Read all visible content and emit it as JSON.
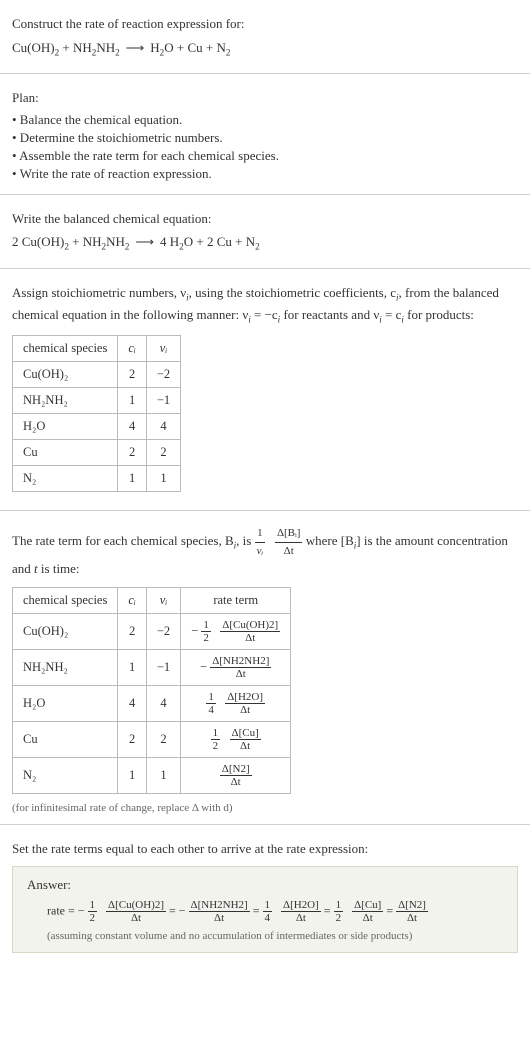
{
  "s1": {
    "intro": "Construct the rate of reaction expression for:",
    "eq_lhs1": "Cu(OH)",
    "eq_lhs1_sub": "2",
    "eq_plus1": " + NH",
    "eq_lhs2_sub": "2",
    "eq_lhs3": "NH",
    "eq_lhs3_sub": "2",
    "arrow": "⟶",
    "rhs1": "H",
    "rhs1_sub": "2",
    "rhs2": "O + Cu + N",
    "rhs2_sub": "2"
  },
  "s2": {
    "title": "Plan:",
    "b1": "• Balance the chemical equation.",
    "b2": "• Determine the stoichiometric numbers.",
    "b3": "• Assemble the rate term for each chemical species.",
    "b4": "• Write the rate of reaction expression."
  },
  "s3": {
    "title": "Write the balanced chemical equation:",
    "c1": "2 Cu(OH)",
    "c1s": "2",
    "c2": " + NH",
    "c2s": "2",
    "c3": "NH",
    "c3s": "2",
    "arrow": "⟶",
    "c4": "4 H",
    "c4s": "2",
    "c5": "O + 2 Cu + N",
    "c5s": "2"
  },
  "s4": {
    "t1": "Assign stoichiometric numbers, ν",
    "t1s": "i",
    "t2": ", using the stoichiometric coefficients, c",
    "t2s": "i",
    "t3": ", from the balanced chemical equation in the following manner: ν",
    "t3s": "i",
    "t4": " = −c",
    "t4s": "i",
    "t5": " for reactants and ν",
    "t5s": "i",
    "t6": " = c",
    "t6s": "i",
    "t7": " for products:",
    "h1": "chemical species",
    "h2": "cᵢ",
    "h3": "νᵢ",
    "r1a": "Cu(OH)₂",
    "r1b": "2",
    "r1c": "−2",
    "r2a": "NH₂NH₂",
    "r2b": "1",
    "r2c": "−1",
    "r3a": "H₂O",
    "r3b": "4",
    "r3c": "4",
    "r4a": "Cu",
    "r4b": "2",
    "r4c": "2",
    "r5a": "N₂",
    "r5b": "1",
    "r5c": "1"
  },
  "s5": {
    "t1": "The rate term for each chemical species, B",
    "t1s": "i",
    "t2": ", is ",
    "f1n": "1",
    "f1d": "νᵢ",
    "f2n": "Δ[Bᵢ]",
    "f2d": "Δt",
    "t3": " where [B",
    "t3s": "i",
    "t4": "] is the amount concentration and ",
    "t5": "t",
    "t6": " is time:",
    "h1": "chemical species",
    "h2": "cᵢ",
    "h3": "νᵢ",
    "h4": "rate term",
    "r1a": "Cu(OH)₂",
    "r1b": "2",
    "r1c": "−2",
    "r1d_pre": "−",
    "r1d_f1n": "1",
    "r1d_f1d": "2",
    "r1d_f2n": "Δ[Cu(OH)2]",
    "r1d_f2d": "Δt",
    "r2a": "NH₂NH₂",
    "r2b": "1",
    "r2c": "−1",
    "r2d_pre": "−",
    "r2d_f2n": "Δ[NH2NH2]",
    "r2d_f2d": "Δt",
    "r3a": "H₂O",
    "r3b": "4",
    "r3c": "4",
    "r3d_f1n": "1",
    "r3d_f1d": "4",
    "r3d_f2n": "Δ[H2O]",
    "r3d_f2d": "Δt",
    "r4a": "Cu",
    "r4b": "2",
    "r4c": "2",
    "r4d_f1n": "1",
    "r4d_f1d": "2",
    "r4d_f2n": "Δ[Cu]",
    "r4d_f2d": "Δt",
    "r5a": "N₂",
    "r5b": "1",
    "r5c": "1",
    "r5d_f2n": "Δ[N2]",
    "r5d_f2d": "Δt",
    "note": "(for infinitesimal rate of change, replace Δ with d)"
  },
  "s6": {
    "title": "Set the rate terms equal to each other to arrive at the rate expression:",
    "answer": "Answer:",
    "rate": "rate = −",
    "f1n": "1",
    "f1d": "2",
    "f2n": "Δ[Cu(OH)2]",
    "f2d": "Δt",
    "eq1": " = −",
    "f3n": "Δ[NH2NH2]",
    "f3d": "Δt",
    "eq2": " = ",
    "f4n": "1",
    "f4d": "4",
    "f5n": "Δ[H2O]",
    "f5d": "Δt",
    "eq3": " = ",
    "f6n": "1",
    "f6d": "2",
    "f7n": "Δ[Cu]",
    "f7d": "Δt",
    "eq4": " = ",
    "f8n": "Δ[N2]",
    "f8d": "Δt",
    "assume": "(assuming constant volume and no accumulation of intermediates or side products)"
  }
}
